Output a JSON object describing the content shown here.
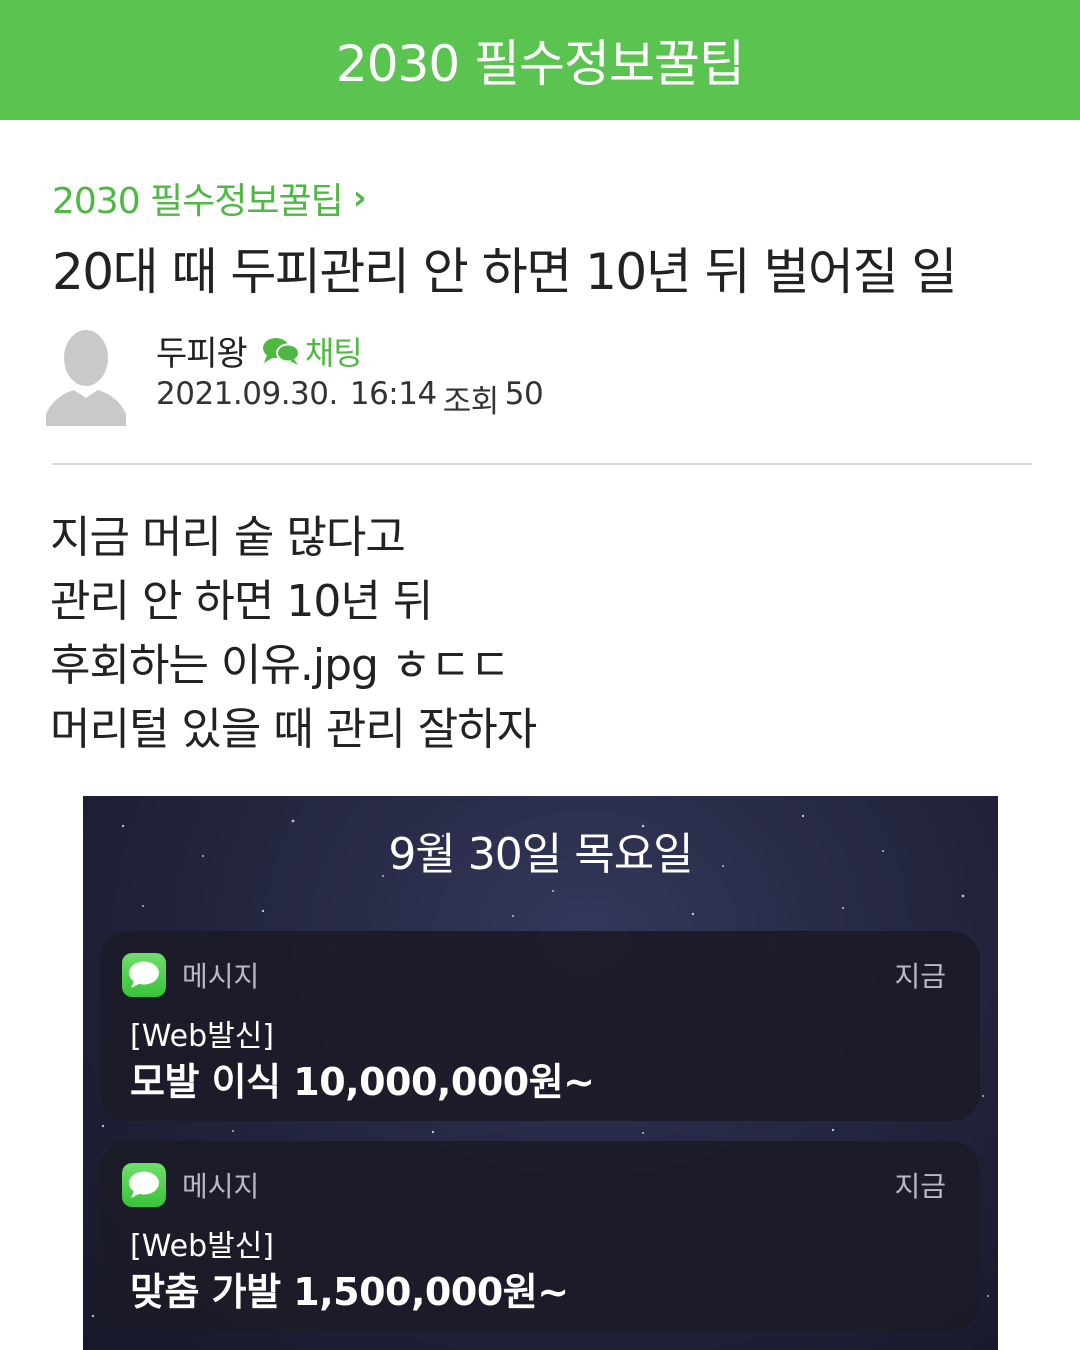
{
  "header": {
    "title": "2030 필수정보꿀팁"
  },
  "board": {
    "name": "2030 필수정보꿀팁",
    "chevron": "›"
  },
  "post": {
    "title": "20대 때 두피관리 안 하면 10년 뒤 벌어질 일",
    "author": "두피왕",
    "chat_label": "채팅",
    "date": "2021.09.30.",
    "time": "16:14",
    "views_label": "조회",
    "views": "50",
    "body_lines": [
      "지금 머리 숱 많다고",
      "관리 안 하면 10년 뒤",
      "후회하는 이유.jpg ㅎㄷㄷ",
      "머리털 있을 때 관리 잘하자"
    ]
  },
  "screenshot": {
    "date": "9월 30일 목요일",
    "notifications": [
      {
        "app": "메시지",
        "time": "지금",
        "sender": "[Web발신]",
        "message": "모발 이식 10,000,000원~"
      },
      {
        "app": "메시지",
        "time": "지금",
        "sender": "[Web발신]",
        "message": "맞춤 가발 1,500,000원~"
      }
    ]
  },
  "colors": {
    "brand_green": "#5bc450",
    "link_green": "#4fb843",
    "divider": "#d8d8d8"
  },
  "icons": {
    "avatar": "default-profile-icon",
    "chat": "chat-bubbles-icon",
    "app": "messages-app-icon"
  }
}
